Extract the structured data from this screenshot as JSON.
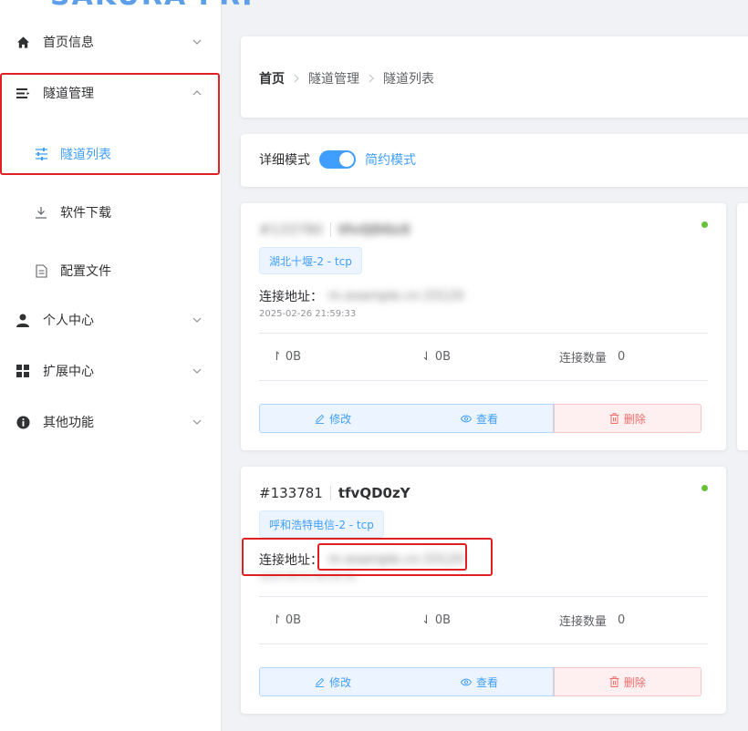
{
  "app": {
    "logo": "SAKURA FRP"
  },
  "sidebar": {
    "items": [
      {
        "label": "首页信息",
        "icon": "home-icon"
      },
      {
        "label": "隧道管理",
        "icon": "list-icon"
      },
      {
        "label": "个人中心",
        "icon": "user-icon"
      },
      {
        "label": "扩展中心",
        "icon": "grid-icon"
      },
      {
        "label": "其他功能",
        "icon": "info-icon"
      }
    ],
    "sub_items": [
      {
        "label": "隧道列表",
        "icon": "sliders-icon",
        "active": true
      },
      {
        "label": "软件下载",
        "icon": "download-icon"
      },
      {
        "label": "配置文件",
        "icon": "file-icon"
      }
    ]
  },
  "breadcrumb": [
    "首页",
    "隧道管理",
    "隧道列表"
  ],
  "mode": {
    "left_label": "详细模式",
    "right_label": "简约模式",
    "toggle_on": true
  },
  "tunnels": [
    {
      "id": "#133781",
      "name": "tfvQD0zY",
      "id_blurred": "#133780",
      "name_blurred": "tfvQD0zX",
      "tag": "湖北十堰-2 - tcp",
      "addr_label": "连接地址：",
      "addr_value": "m.example.cn:33120",
      "time": "2025-02-26 21:59:33",
      "up": "0B",
      "down": "0B",
      "conn_label": "连接数量",
      "conn_value": "0",
      "status_color": "#67c23a",
      "edit": "修改",
      "view": "查看",
      "delete": "删除"
    },
    {
      "id": "#133781",
      "name": "tfvQD0zY",
      "tag": "呼和浩特电信-2 - tcp",
      "addr_label": "连接地址：",
      "addr_value": "m.example.cn:33120",
      "time": "2025-04-21 00:00:50",
      "up": "0B",
      "down": "0B",
      "conn_label": "连接数量",
      "conn_value": "0",
      "status_color": "#67c23a",
      "edit": "修改",
      "view": "查看",
      "delete": "删除"
    }
  ]
}
